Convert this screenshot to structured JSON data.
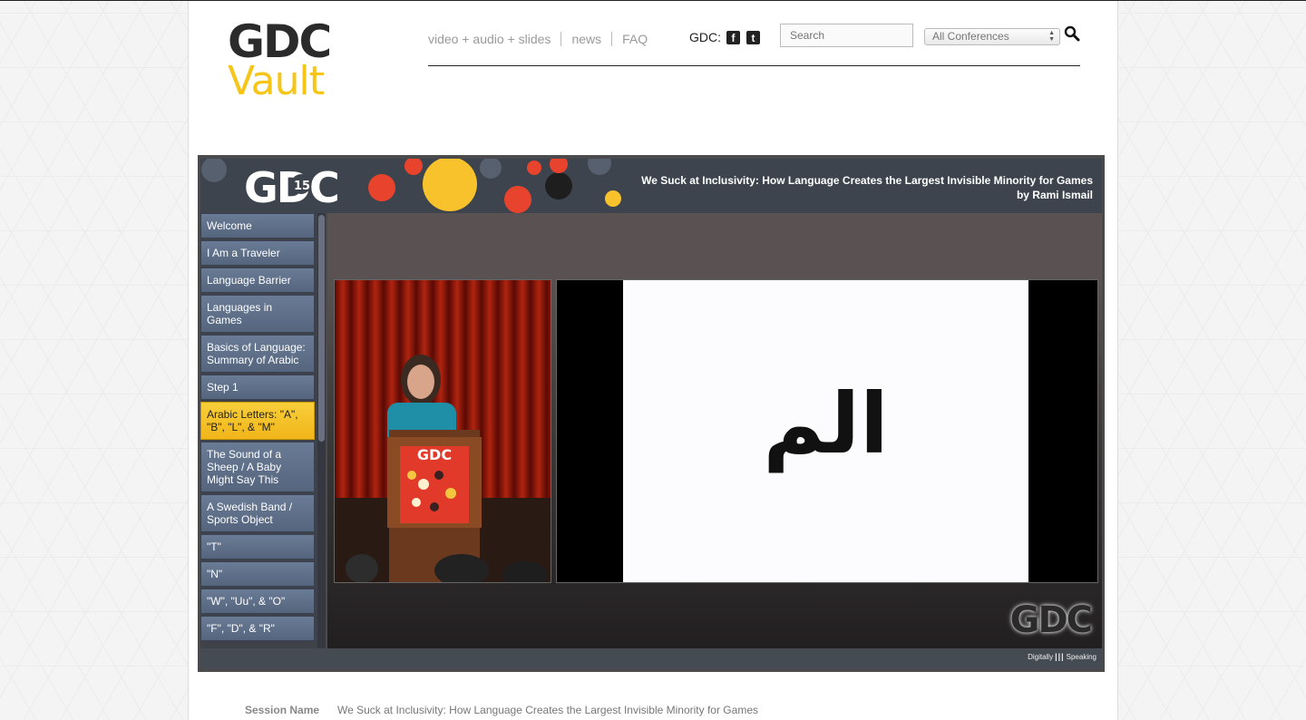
{
  "logo": {
    "line1": "GDC",
    "line2": "Vault"
  },
  "nav": {
    "items": [
      "video + audio + slides",
      "news",
      "FAQ"
    ]
  },
  "social": {
    "label": "GDC:",
    "icons": [
      "facebook-icon",
      "twitter-icon"
    ],
    "facebook_glyph": "f",
    "twitter_glyph": "t"
  },
  "search": {
    "placeholder": "Search"
  },
  "conference_filter": {
    "selected": "All Conferences"
  },
  "player": {
    "banner_logo": "GDC",
    "title": "We Suck at Inclusivity: How Language Creates the Largest Invisible Minority for Games",
    "speaker": "by Rami Ismail",
    "chapters": [
      "Welcome",
      "I Am a Traveler",
      "Language Barrier",
      "Languages in Games",
      "Basics of Language: Summary of Arabic",
      "Step 1",
      "Arabic Letters: \"A\", \"B\", \"L\", & \"M\"",
      "The Sound of a Sheep / A Baby Might Say This",
      "A Swedish Band / Sports Object",
      "\"T\"",
      "\"N\"",
      "\"W\", \"Uu\", & \"O\"",
      "\"F\", \"D\", & \"R\""
    ],
    "active_chapter_index": 6,
    "slide_text": "الم",
    "watermark": "GDC",
    "credit_left": "Digitally",
    "credit_right": "Speaking"
  },
  "session": {
    "label": "Session Name",
    "value": "We Suck at Inclusivity: How Language Creates the Largest Invisible Minority for Games"
  },
  "colors": {
    "accent_yellow": "#f5c518",
    "chapter_blue": "#5f708a",
    "dark": "#2b2b2b"
  }
}
